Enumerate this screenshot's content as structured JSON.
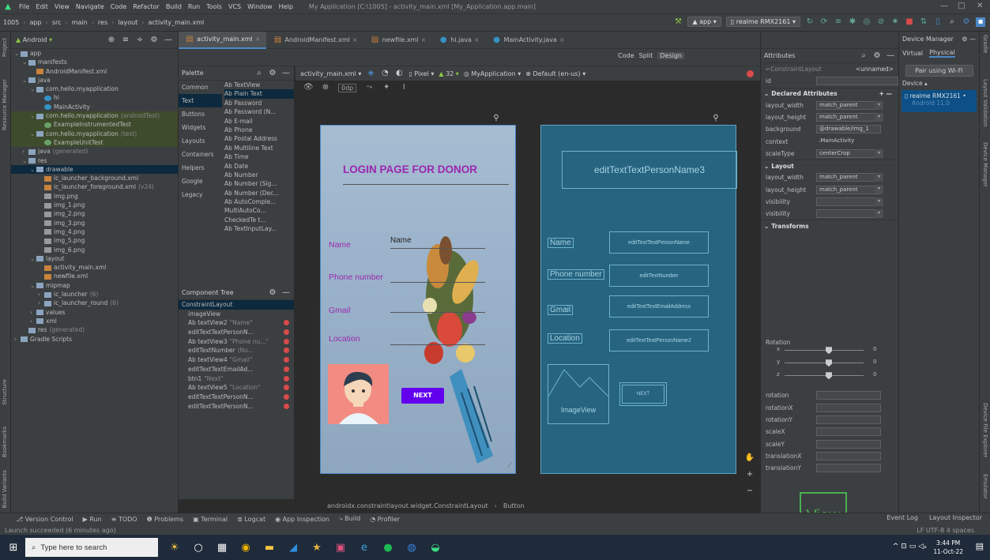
{
  "titlebar": {
    "menus": [
      "File",
      "Edit",
      "View",
      "Navigate",
      "Code",
      "Refactor",
      "Build",
      "Run",
      "Tools",
      "VCS",
      "Window",
      "Help"
    ],
    "title": "My Application [C:\\1005] - activity_main.xml [My_Application.app.main]"
  },
  "navbar": {
    "crumbs": [
      "1005",
      "app",
      "src",
      "main",
      "res",
      "layout",
      "activity_main.xml"
    ],
    "run_config": "app",
    "device": "realme RMX2161"
  },
  "project": {
    "view": "Android",
    "items": [
      {
        "t": "app",
        "d": 0,
        "k": "dir",
        "x": "v"
      },
      {
        "t": "manifests",
        "d": 1,
        "k": "dir",
        "x": "v"
      },
      {
        "t": "AndroidManifest.xml",
        "d": 2,
        "k": "xml",
        "x": ""
      },
      {
        "t": "java",
        "d": 1,
        "k": "dir",
        "x": "v"
      },
      {
        "t": "com.hello.myapplication",
        "d": 2,
        "k": "dir",
        "x": "v"
      },
      {
        "t": "hi",
        "d": 3,
        "k": "cls",
        "x": ""
      },
      {
        "t": "MainActivity",
        "d": 3,
        "k": "cls",
        "x": ""
      },
      {
        "t": "com.hello.myapplication",
        "g": "(androidTest)",
        "d": 2,
        "k": "dir",
        "x": "v",
        "s": "test"
      },
      {
        "t": "ExampleInstrumentedTest",
        "d": 3,
        "k": "test",
        "x": "",
        "s": "test"
      },
      {
        "t": "com.hello.myapplication",
        "g": "(test)",
        "d": 2,
        "k": "dir",
        "x": "v",
        "s": "test"
      },
      {
        "t": "ExampleUnitTest",
        "d": 3,
        "k": "test",
        "x": "",
        "s": "test"
      },
      {
        "t": "java",
        "g": "(generated)",
        "d": 1,
        "k": "dir",
        "x": ">"
      },
      {
        "t": "res",
        "d": 1,
        "k": "dir",
        "x": "v"
      },
      {
        "t": "drawable",
        "d": 2,
        "k": "dir",
        "x": "v",
        "s": "sel"
      },
      {
        "t": "ic_launcher_background.xml",
        "d": 3,
        "k": "xml",
        "x": ""
      },
      {
        "t": "ic_launcher_foreground.xml",
        "g": "(v24)",
        "d": 3,
        "k": "xml",
        "x": ""
      },
      {
        "t": "img.png",
        "d": 3,
        "k": "png",
        "x": ""
      },
      {
        "t": "img_1.png",
        "d": 3,
        "k": "png",
        "x": ""
      },
      {
        "t": "img_2.png",
        "d": 3,
        "k": "png",
        "x": ""
      },
      {
        "t": "img_3.png",
        "d": 3,
        "k": "png",
        "x": ""
      },
      {
        "t": "img_4.png",
        "d": 3,
        "k": "png",
        "x": ""
      },
      {
        "t": "img_5.png",
        "d": 3,
        "k": "png",
        "x": ""
      },
      {
        "t": "img_6.png",
        "d": 3,
        "k": "png",
        "x": ""
      },
      {
        "t": "layout",
        "d": 2,
        "k": "dir",
        "x": "v"
      },
      {
        "t": "activity_main.xml",
        "d": 3,
        "k": "xml",
        "x": ""
      },
      {
        "t": "newfile.xml",
        "d": 3,
        "k": "xml",
        "x": ""
      },
      {
        "t": "mipmap",
        "d": 2,
        "k": "dir",
        "x": "v"
      },
      {
        "t": "ic_launcher",
        "g": "(6)",
        "d": 3,
        "k": "dir",
        "x": ">"
      },
      {
        "t": "ic_launcher_round",
        "g": "(6)",
        "d": 3,
        "k": "dir",
        "x": ">"
      },
      {
        "t": "values",
        "d": 2,
        "k": "dir",
        "x": ">"
      },
      {
        "t": "xml",
        "d": 2,
        "k": "dir",
        "x": ">"
      },
      {
        "t": "res",
        "g": "(generated)",
        "d": 1,
        "k": "dir",
        "x": ""
      },
      {
        "t": "Gradle Scripts",
        "d": 0,
        "k": "dir",
        "x": ">"
      }
    ]
  },
  "tabs": [
    "activity_main.xml",
    "AndroidManifest.xml",
    "newfile.xml",
    "hi.java",
    "MainActivity.java"
  ],
  "palette": {
    "title": "Palette",
    "categories": [
      "Common",
      "Text",
      "Buttons",
      "Widgets",
      "Layouts",
      "Containers",
      "Helpers",
      "Google",
      "Legacy"
    ],
    "items": [
      "Ab TextView",
      "Ab Plain Text",
      "Ab Password",
      "Ab Password (N...",
      "Ab E-mail",
      "Ab Phone",
      "Ab Postal Address",
      "Ab Multiline Text",
      "Ab Time",
      "Ab Date",
      "Ab Number",
      "Ab Number (Sig...",
      "Ab Number (Dec...",
      "Ab AutoComple...",
      "MultiAutoCo...",
      "CheckedTe t...",
      "Ab TextInputLay..."
    ]
  },
  "component_tree": {
    "title": "Component Tree",
    "items": [
      {
        "t": "ConstraintLayout",
        "e": false,
        "sel": true,
        "d": 0
      },
      {
        "t": "imageView",
        "e": false,
        "d": 1
      },
      {
        "t": "Ab textView2",
        "g": "\"Name\"",
        "e": true,
        "d": 1
      },
      {
        "t": "editTextTextPersonN...",
        "e": true,
        "d": 1
      },
      {
        "t": "Ab textView3",
        "g": "\"Phone nu...\"",
        "e": true,
        "d": 1
      },
      {
        "t": "editTextNumber",
        "g": "(Nu...",
        "e": true,
        "d": 1
      },
      {
        "t": "Ab textView4",
        "g": "\"Gmail\"",
        "e": true,
        "d": 1
      },
      {
        "t": "editTextTextEmailAd...",
        "e": true,
        "d": 1
      },
      {
        "t": "btn1",
        "g": "\"Next\"",
        "e": true,
        "d": 1
      },
      {
        "t": "Ab textView5",
        "g": "\"Location\"",
        "e": true,
        "d": 1
      },
      {
        "t": "editTextTextPersonN...",
        "e": true,
        "d": 1
      },
      {
        "t": "editTextTextPersonN...",
        "e": true,
        "d": 1
      }
    ]
  },
  "design_toolbar": {
    "file": "activity_main.xml",
    "device": "Pixel",
    "api": "32",
    "theme": "MyApplication",
    "locale": "Default (en-us)",
    "margin": "0dp"
  },
  "preview": {
    "title": "LOGIN PAGE FOR DONOR",
    "name_label": "Name",
    "name_value": "Name",
    "phone_label": "Phone number",
    "gmail_label": "Gmail",
    "location_label": "Location",
    "next": "NEXT"
  },
  "blueprint": {
    "edit3": "editTextTextPersonName3",
    "name": "Name",
    "edit_name": "editTextTextPersonName",
    "phone": "Phone number",
    "edit_number": "editTextNumber",
    "gmail": "Gmail",
    "edit_email": "editTextTextEmailAddress",
    "location": "Location",
    "edit_name2": "editTextTextPersonName2",
    "imageview": "ImageView",
    "next": "NEXT"
  },
  "breadcrumb": [
    "androidx.constraintlayout.widget.ConstraintLayout",
    "Button"
  ],
  "view_modes": [
    "Code",
    "Split",
    "Design"
  ],
  "attributes": {
    "title": "Attributes",
    "component": "ConstraintLayout",
    "unnamed": "<unnamed>",
    "id_label": "id",
    "declared_title": "Declared Attributes",
    "declared": [
      {
        "k": "layout_width",
        "v": "match_parent",
        "dd": true
      },
      {
        "k": "layout_height",
        "v": "match_parent",
        "dd": true
      },
      {
        "k": "background",
        "v": "@drawable/img_1",
        "dd": false
      },
      {
        "k": "context",
        "v": ".MainActivity",
        "dd": false,
        "plain": true
      },
      {
        "k": "scaleType",
        "v": "centerCrop",
        "dd": true
      }
    ],
    "layout_title": "Layout",
    "layout": [
      {
        "k": "layout_width",
        "v": "match_parent",
        "dd": true
      },
      {
        "k": "layout_height",
        "v": "match_parent",
        "dd": true
      },
      {
        "k": "visibility",
        "v": "",
        "dd": true
      },
      {
        "k": "visibility",
        "v": "",
        "dd": true
      }
    ],
    "transforms_title": "Transforms",
    "view_label": "View",
    "rotation_label": "Rotation",
    "axes": [
      "x",
      "y",
      "z"
    ],
    "axis_value": "0",
    "transforms": [
      "rotation",
      "rotationX",
      "rotationY",
      "scaleX",
      "scaleY",
      "translationX",
      "translationY"
    ]
  },
  "device_manager": {
    "title": "Device Manager",
    "tabs": [
      "Virtual",
      "Physical"
    ],
    "pair": "Pair using Wi-Fi",
    "device_header": "Device",
    "device_name": "realme RMX2161",
    "device_os": "Android 11.0"
  },
  "status": {
    "tools": [
      "Version Control",
      "Run",
      "TODO",
      "Problems",
      "Terminal",
      "Logcat",
      "App Inspection",
      "Build",
      "Profiler"
    ],
    "right": [
      "Event Log",
      "Layout Inspector"
    ],
    "message": "Launch succeeded (6 minutes ago)",
    "info": "LF  UTF-8  4 spaces"
  },
  "taskbar": {
    "search": "Type here to search",
    "time": "3:44 PM",
    "date": "11-Oct-22"
  },
  "colors": {
    "accent": "#4a88c7",
    "purple": "#9c27b0",
    "button": "#6200ee",
    "blueprint": "#266480"
  }
}
